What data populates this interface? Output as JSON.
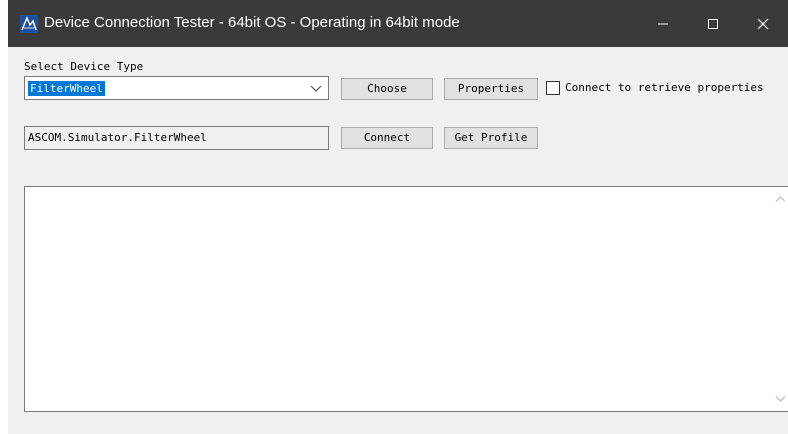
{
  "window": {
    "title": "Device Connection Tester - 64bit OS - Operating in 64bit mode",
    "icon": "ascom-app-icon",
    "controls": [
      "minimize-icon",
      "maximize-icon",
      "close-icon"
    ]
  },
  "device_type": {
    "label": "Select Device Type",
    "selected": "FilterWheel"
  },
  "buttons": {
    "choose": "Choose",
    "properties": "Properties",
    "connect": "Connect",
    "get_profile": "Get Profile"
  },
  "connect_checkbox": {
    "label": "Connect to retrieve properties",
    "checked": false
  },
  "prog_id": "ASCOM.Simulator.FilterWheel",
  "output": {
    "text": ""
  },
  "colors": {
    "titlebar": "#3a3a3a",
    "selection": "#0078d7",
    "window_bg": "#f0f0f0"
  }
}
